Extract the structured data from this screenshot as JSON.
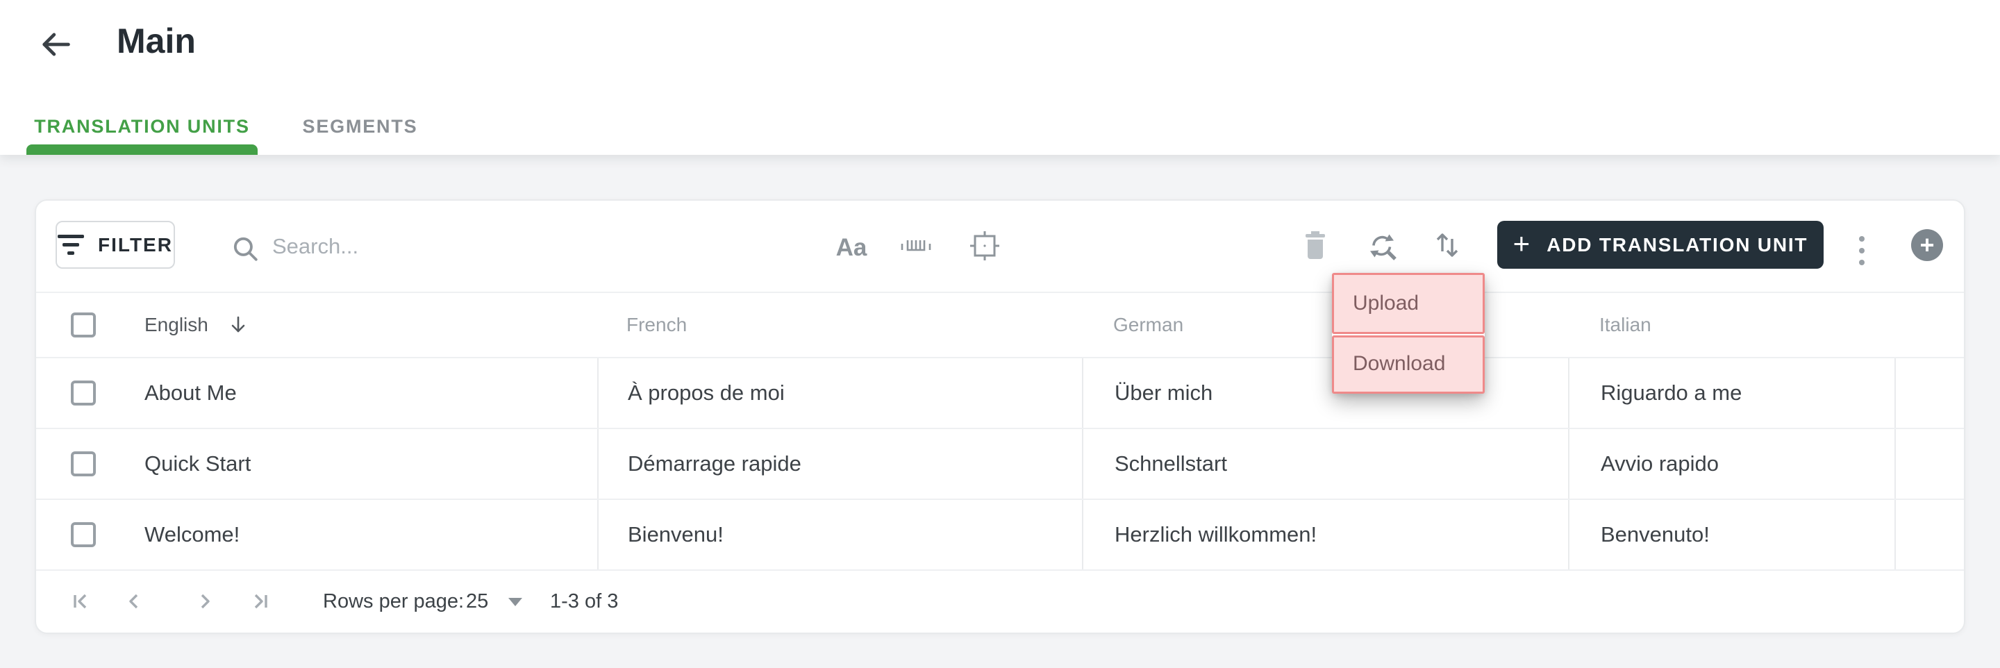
{
  "header": {
    "title": "Main",
    "back_icon": "arrow-left"
  },
  "tabs": [
    {
      "label": "TRANSLATION UNITS",
      "active": true
    },
    {
      "label": "SEGMENTS",
      "active": false
    }
  ],
  "toolbar": {
    "filter_label": "FILTER",
    "search_placeholder": "Search...",
    "match_case_icon_text": "Aa",
    "icons": [
      "filter-icon",
      "search-icon",
      "match-case-icon",
      "match-whole-word-icon",
      "target-icon",
      "trash-icon",
      "search-replace-icon",
      "import-export-icon",
      "kebab-menu-icon",
      "plus-circle-icon"
    ],
    "add_button_plus": "+",
    "add_button_label": "ADD TRANSLATION UNIT",
    "create_plus": "+"
  },
  "table": {
    "columns": [
      {
        "label": "English",
        "sort": "descending"
      },
      {
        "label": "French",
        "sort": null
      },
      {
        "label": "German",
        "sort": null
      },
      {
        "label": "Italian",
        "sort": null
      }
    ],
    "rows": [
      {
        "english": "About Me",
        "french": "À propos de moi",
        "german": "Über mich",
        "italian": "Riguardo a me"
      },
      {
        "english": "Quick Start",
        "french": "Démarrage rapide",
        "german": "Schnellstart",
        "italian": "Avvio rapido"
      },
      {
        "english": "Welcome!",
        "french": "Bienvenu!",
        "german": "Herzlich willkommen!",
        "italian": "Benvenuto!"
      }
    ]
  },
  "pagination": {
    "rows_per_page_label": "Rows per page:",
    "rows_per_page_value": "25",
    "range_label": "1-3 of 3"
  },
  "menu": {
    "items": [
      {
        "label": "Upload"
      },
      {
        "label": "Download"
      }
    ]
  },
  "colors": {
    "accent_green": "#43a047",
    "dark_button": "#243039",
    "annotation_border": "#ef8a8a",
    "annotation_fill": "rgba(244,148,148,0.30)",
    "page_background": "#f3f4f6"
  }
}
